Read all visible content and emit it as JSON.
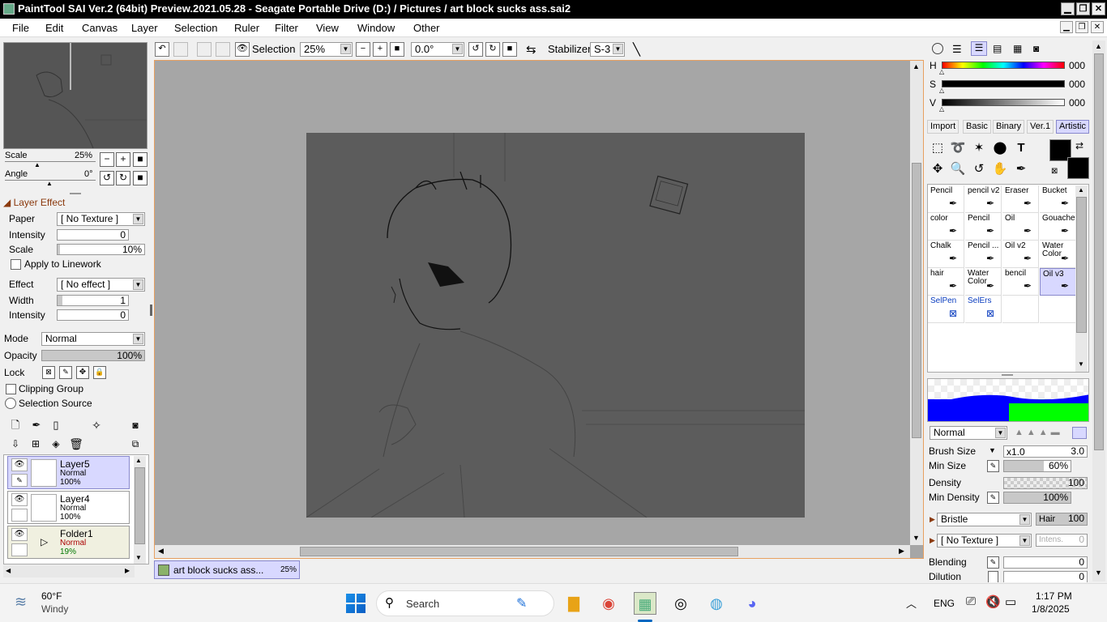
{
  "window": {
    "title": "PaintTool SAI Ver.2 (64bit) Preview.2021.05.28 - Seagate Portable Drive (D:) / Pictures / art block sucks ass.sai2",
    "minimize": "▁",
    "restore": "❐",
    "close": "✕"
  },
  "menu": [
    "File",
    "Edit",
    "Canvas",
    "Layer",
    "Selection",
    "Ruler",
    "Filter",
    "View",
    "Window",
    "Other"
  ],
  "navigator": {
    "scale_label": "Scale",
    "scale_value": "25%",
    "angle_label": "Angle",
    "angle_value": "0°"
  },
  "layer_effect": {
    "header": "Layer Effect",
    "paper_label": "Paper",
    "paper_value": "[ No Texture ]",
    "intensity_label": "Intensity",
    "intensity_value": "0",
    "scale_label": "Scale",
    "scale_value": "10%",
    "apply_linework": "Apply to Linework",
    "effect_label": "Effect",
    "effect_value": "[ No effect ]",
    "width_label": "Width",
    "width_value": "1",
    "intensity2_label": "Intensity",
    "intensity2_value": "0"
  },
  "layer_props": {
    "mode_label": "Mode",
    "mode_value": "Normal",
    "opacity_label": "Opacity",
    "opacity_value": "100%",
    "lock_label": "Lock",
    "clipping_group": "Clipping Group",
    "selection_source": "Selection Source"
  },
  "layers": [
    {
      "name": "Layer5",
      "mode": "Normal",
      "opacity": "100%"
    },
    {
      "name": "Layer4",
      "mode": "Normal",
      "opacity": "100%"
    },
    {
      "name": "Folder1",
      "mode": "Normal",
      "opacity": "19%"
    }
  ],
  "toolbar": {
    "selection_label": "Selection",
    "zoom_value": "25%",
    "angle_value": "0.0°",
    "stabilizer_label": "Stabilizer",
    "stabilizer_value": "S-3"
  },
  "doc_tab": {
    "name": "art block sucks ass...",
    "zoom": "25%"
  },
  "color": {
    "h_label": "H",
    "h_value": "000",
    "s_label": "S",
    "s_value": "000",
    "v_label": "V",
    "v_value": "000",
    "primary": "#000000",
    "secondary": "#000000"
  },
  "brush_tabs": [
    "Import",
    "Basic",
    "Binary",
    "Ver.1",
    "Artistic"
  ],
  "brushes": [
    [
      "Pencil",
      "pencil v2",
      "Eraser",
      "Bucket"
    ],
    [
      "color",
      "Pencil",
      "Oil",
      "Gouache"
    ],
    [
      "Chalk",
      "Pencil ...",
      "Oil v2",
      "Water Color"
    ],
    [
      "hair",
      "Water Color",
      "bencil",
      "Oil v3"
    ],
    [
      "SelPen",
      "SelErs",
      "",
      ""
    ]
  ],
  "brush_settings": {
    "blend_mode": "Normal",
    "brush_size_label": "Brush Size",
    "brush_size_mult": "x1.0",
    "brush_size_value": "3.0",
    "min_size_label": "Min Size",
    "min_size_value": "60%",
    "density_label": "Density",
    "density_value": "100",
    "min_density_label": "Min Density",
    "min_density_value": "100%",
    "shape_value": "Bristle",
    "hair_label": "Hair",
    "hair_value": "100",
    "texture_value": "[ No Texture ]",
    "intens_label": "Intens.",
    "intens_value": "0",
    "blending_label": "Blending",
    "blending_value": "0",
    "dilution_label": "Dilution",
    "dilution_value": "0"
  },
  "taskbar": {
    "weather_temp": "60°F",
    "weather_desc": "Windy",
    "search_placeholder": "Search",
    "language": "ENG",
    "time": "1:17 PM",
    "date": "1/8/2025"
  }
}
